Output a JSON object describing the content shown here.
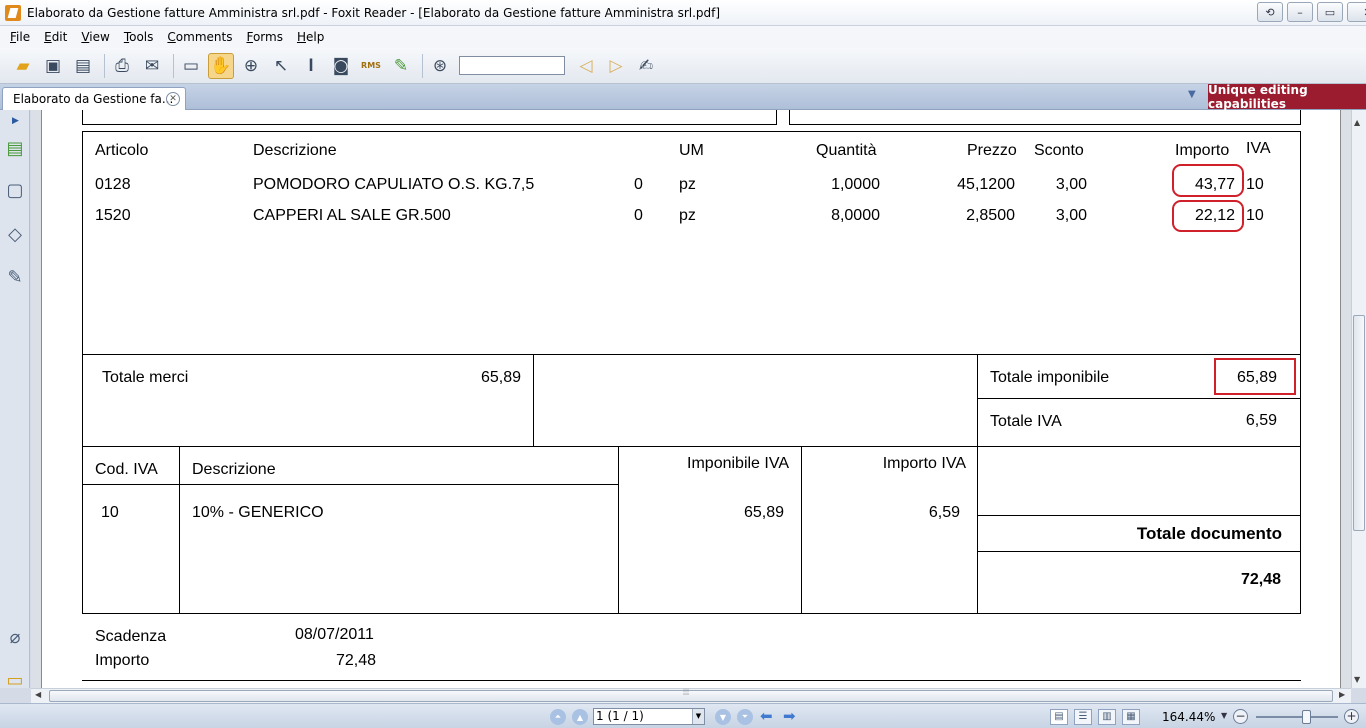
{
  "window": {
    "title": "Elaborato da Gestione fatture Amministra srl.pdf - Foxit Reader - [Elaborato da Gestione fatture Amministra srl.pdf]",
    "controls": [
      "restore-down",
      "minimize",
      "maximize",
      "close"
    ]
  },
  "menu": [
    "File",
    "Edit",
    "View",
    "Tools",
    "Comments",
    "Forms",
    "Help"
  ],
  "toolbar": {
    "icons": [
      "open-icon",
      "save-icon",
      "save-all-icon",
      "print-icon",
      "email-icon",
      "monitor-icon",
      "hand-icon",
      "zoom-icon",
      "select-icon",
      "text-icon",
      "snapshot-icon",
      "rms-icon",
      "sign-icon",
      "binoculars-icon",
      "find-prev-icon",
      "find-next-icon",
      "typewriter-icon"
    ],
    "rms_label": "RMS",
    "find_value": ""
  },
  "tabs": {
    "active": "Elaborato da Gestione fa...",
    "promo": "Unique editing capabilities"
  },
  "invoice": {
    "headers": {
      "articolo": "Articolo",
      "descrizione": "Descrizione",
      "um": "UM",
      "quantita": "Quantità",
      "prezzo": "Prezzo",
      "sconto": "Sconto",
      "importo": "Importo",
      "iva": "IVA"
    },
    "rows": [
      {
        "articolo": "0128",
        "descrizione": "POMODORO CAPULIATO O.S. KG.7,5",
        "zero": "0",
        "um": "pz",
        "quantita": "1,0000",
        "prezzo": "45,1200",
        "sconto": "3,00",
        "importo": "43,77",
        "iva": "10"
      },
      {
        "articolo": "1520",
        "descrizione": "CAPPERI AL SALE GR.500",
        "zero": "0",
        "um": "pz",
        "quantita": "8,0000",
        "prezzo": "2,8500",
        "sconto": "3,00",
        "importo": "22,12",
        "iva": "10"
      }
    ],
    "totals": {
      "merci_label": "Totale merci",
      "merci_value": "65,89",
      "imponibile_label": "Totale imponibile",
      "imponibile_value": "65,89",
      "iva_label": "Totale IVA",
      "iva_value": "6,59"
    },
    "iva_table": {
      "headers": {
        "cod": "Cod. IVA",
        "descrizione": "Descrizione",
        "imponibile": "Imponibile IVA",
        "importo": "Importo IVA"
      },
      "rows": [
        {
          "cod": "10",
          "descrizione": "10% - GENERICO",
          "imponibile": "65,89",
          "importo": "6,59"
        }
      ]
    },
    "documento": {
      "label": "Totale documento",
      "value": "72,48"
    },
    "scadenza": {
      "label": "Scadenza",
      "date": "08/07/2011",
      "importo_label": "Importo",
      "importo_value": "72,48"
    }
  },
  "status": {
    "page_field": "1 (1 / 1)",
    "zoom": "164.44%"
  }
}
